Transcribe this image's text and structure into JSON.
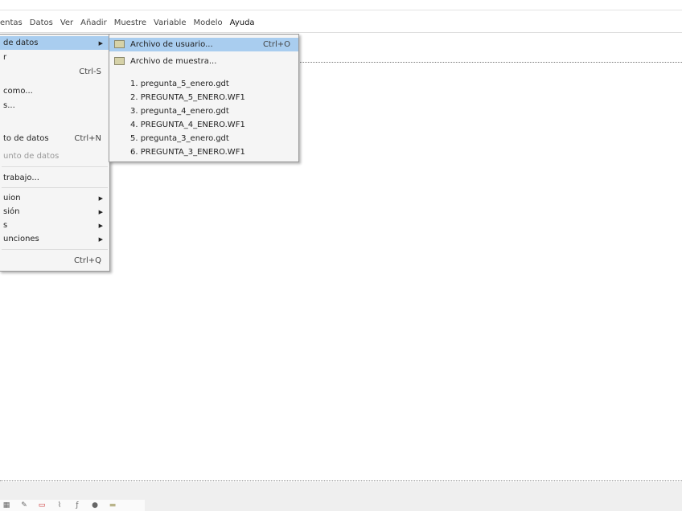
{
  "menubar": [
    "entas",
    "Datos",
    "Ver",
    "Añadir",
    "Muestre",
    "Variable",
    "Modelo",
    "Ayuda"
  ],
  "main_menu": [
    {
      "label": "de datos",
      "shortcut": "",
      "arrow": true,
      "hl": true
    },
    {
      "label": "r",
      "shortcut": ""
    },
    {
      "label": "",
      "shortcut": "Ctrl-S"
    },
    {
      "label": "como...",
      "shortcut": ""
    },
    {
      "label": "s...",
      "shortcut": ""
    },
    {
      "label": "to de datos",
      "shortcut": "Ctrl+N"
    },
    {
      "label": "unto de datos",
      "shortcut": "",
      "disabled": true
    },
    {
      "label": "trabajo...",
      "shortcut": ""
    },
    {
      "label": "uion",
      "arrow": true
    },
    {
      "label": "sión",
      "arrow": true
    },
    {
      "label": "s",
      "arrow": true
    },
    {
      "label": "unciones",
      "arrow": true
    },
    {
      "label": "",
      "shortcut": "Ctrl+Q"
    }
  ],
  "submenu": {
    "user_file": "Archivo de usuario...",
    "user_shortcut": "Ctrl+O",
    "sample_file": "Archivo de muestra...",
    "recent": [
      "1. pregunta_5_enero.gdt",
      "2. PREGUNTA_5_ENERO.WF1",
      "3. pregunta_4_enero.gdt",
      "4. PREGUNTA_4_ENERO.WF1",
      "5. pregunta_3_enero.gdt",
      "6. PREGUNTA_3_ENERO.WF1"
    ]
  },
  "arrow": "▶"
}
